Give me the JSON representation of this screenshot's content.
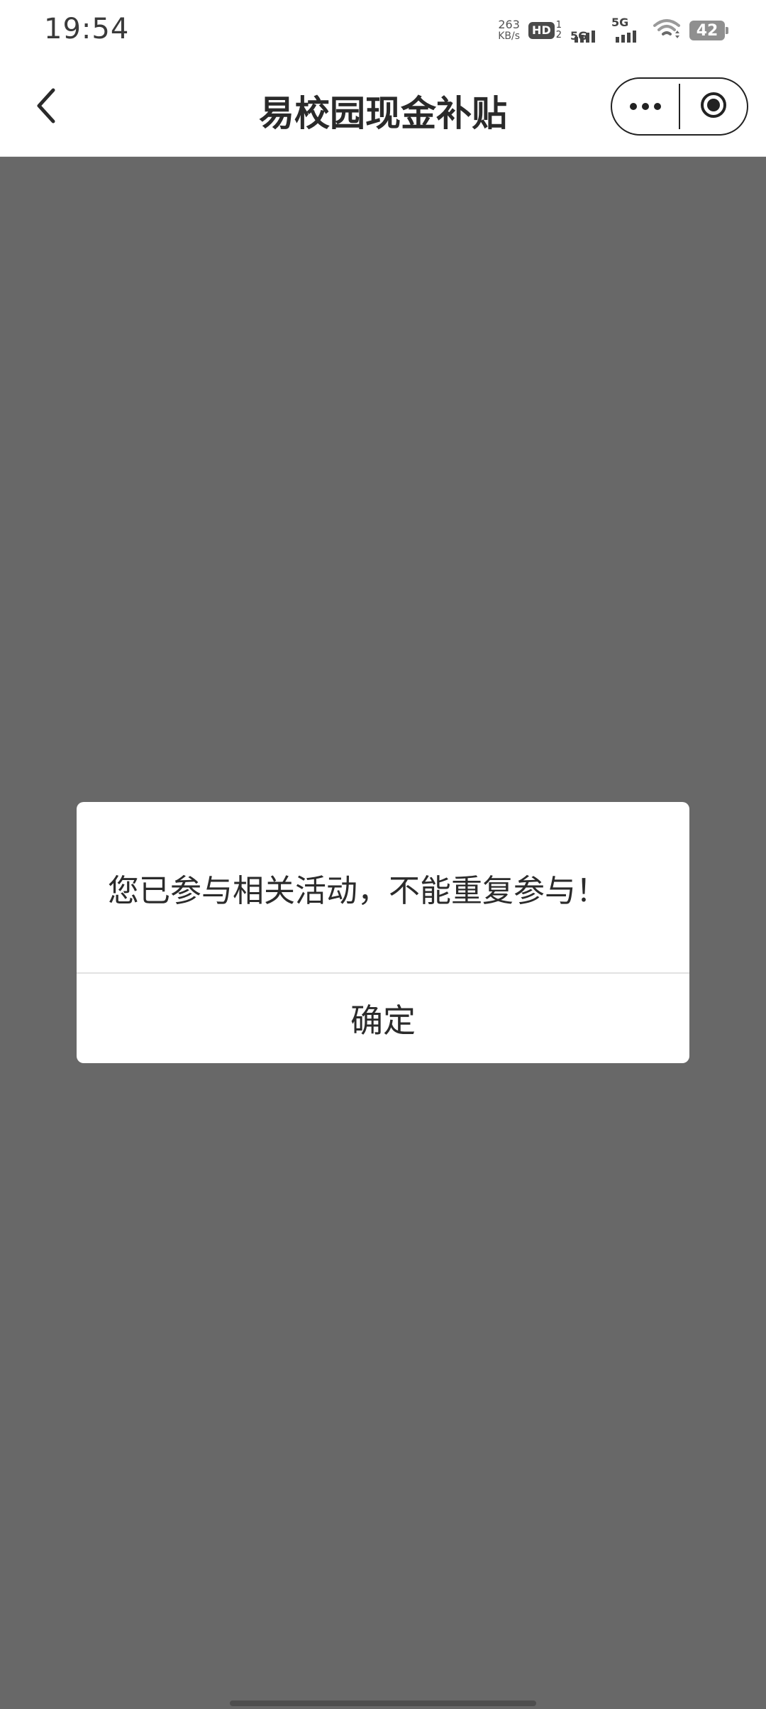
{
  "status_bar": {
    "time": "19:54",
    "net_speed_value": "263",
    "net_speed_unit": "KB/s",
    "hd_label": "HD",
    "hd_sim_top": "1",
    "hd_sim_bottom": "2",
    "sim1_network": "5G",
    "sim2_network": "5G",
    "battery_level": "42",
    "icons": [
      "hd-voice-icon",
      "signal-5g-icon",
      "signal-5g-icon",
      "wifi-icon",
      "battery-icon"
    ]
  },
  "nav_bar": {
    "title": "易校园现金补贴",
    "back_icon": "chevron-left-icon",
    "more_icon": "more-dots-icon",
    "close_icon": "record-circle-icon"
  },
  "colors": {
    "overlay": "#686868",
    "modal_bg": "#ffffff",
    "text": "#2b2b2b"
  },
  "dialog": {
    "message": "您已参与相关活动，不能重复参与！",
    "confirm_label": "确定"
  }
}
